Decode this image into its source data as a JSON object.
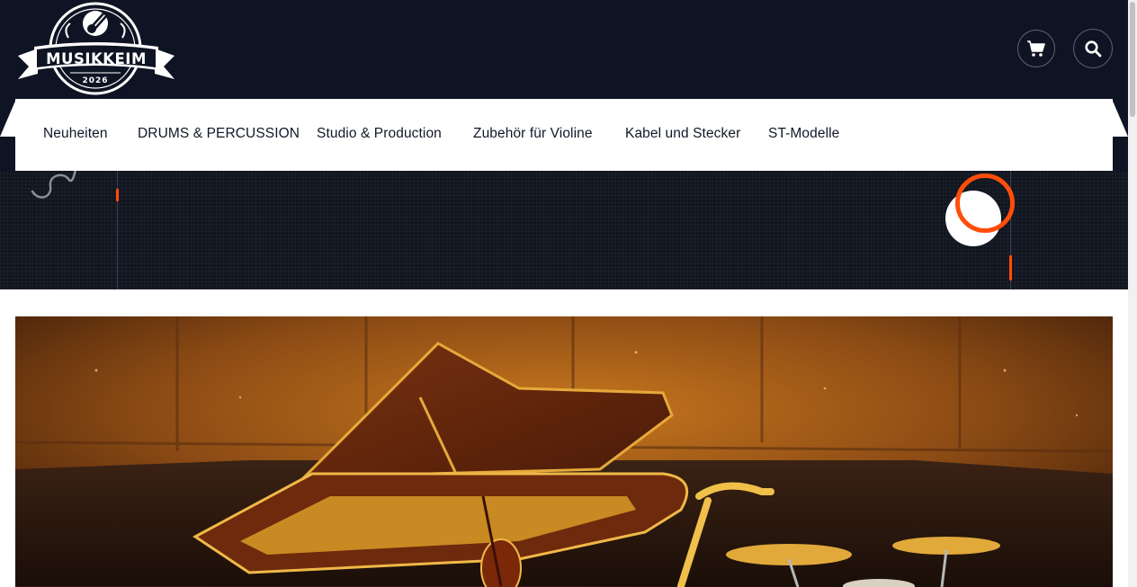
{
  "brand": {
    "name": "MUSIKKEIM",
    "year": "2026"
  },
  "header": {
    "cart_icon": "cart-icon",
    "search_icon": "search-icon"
  },
  "nav": {
    "items": [
      {
        "label": "Neuheiten"
      },
      {
        "label": "DRUMS & PERCUSSION"
      },
      {
        "label": "Studio & Production"
      },
      {
        "label": "Zubehör für Violine"
      },
      {
        "label": "Kabel und Stecker"
      },
      {
        "label": "ST-Modelle"
      }
    ]
  },
  "colors": {
    "header_bg": "#0f1424",
    "accent": "#ff4d0a",
    "nav_bg": "#ffffff",
    "text": "#111827"
  },
  "hero": {
    "image": "grand piano with violin, saxophone and drum kit in warm-lit studio"
  }
}
